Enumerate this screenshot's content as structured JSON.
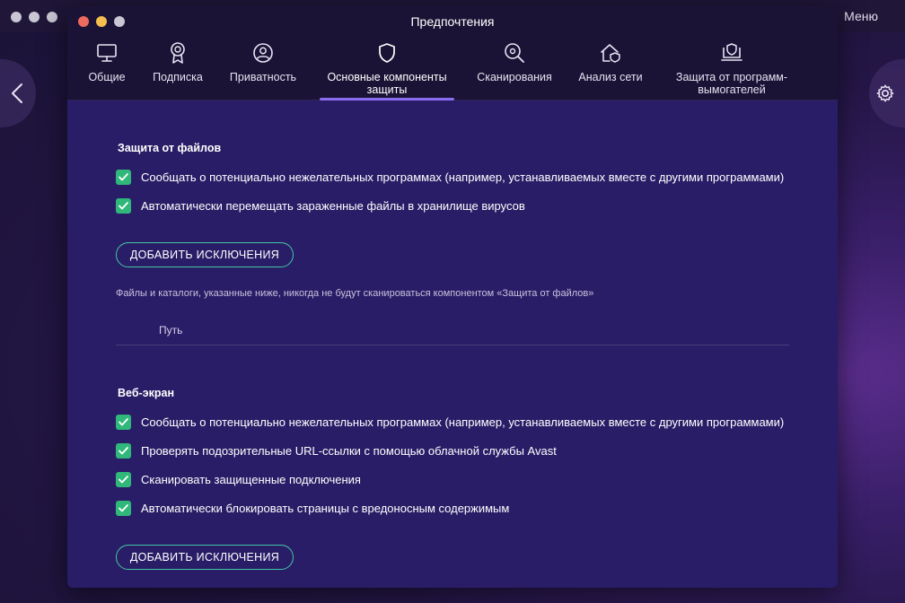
{
  "background": {
    "menu_label": "Меню"
  },
  "window": {
    "title": "Предпочтения"
  },
  "tabs": [
    {
      "label": "Общие",
      "icon": "monitor-icon"
    },
    {
      "label": "Подписка",
      "icon": "badge-icon"
    },
    {
      "label": "Приватность",
      "icon": "fingerprint-icon"
    },
    {
      "label": "Основные компоненты защиты",
      "icon": "shield-icon",
      "active": true
    },
    {
      "label": "Сканирования",
      "icon": "scan-gear-icon"
    },
    {
      "label": "Анализ сети",
      "icon": "home-shield-icon"
    },
    {
      "label": "Защита от программ-вымогателей",
      "icon": "laptop-shield-icon"
    }
  ],
  "file_shield": {
    "title": "Защита от файлов",
    "options": [
      "Сообщать о потенциально нежелательных программах (например, устанавливаемых вместе с другими программами)",
      "Автоматически перемещать зараженные файлы в хранилище вирусов"
    ],
    "add_exceptions_label": "ДОБАВИТЬ ИСКЛЮЧЕНИЯ",
    "note": "Файлы и каталоги, указанные ниже, никогда не будут сканироваться компонентом «Защита от файлов»",
    "column_path": "Путь"
  },
  "web_shield": {
    "title": "Веб-экран",
    "options": [
      "Сообщать о потенциально нежелательных программах (например, устанавливаемых вместе с другими программами)",
      "Проверять подозрительные URL-ссылки с помощью облачной службы Avast",
      "Сканировать защищенные подключения",
      "Автоматически блокировать страницы с вредоносным содержимым"
    ],
    "add_exceptions_label": "ДОБАВИТЬ ИСКЛЮЧЕНИЯ"
  },
  "colors": {
    "accent": "#8a6cf0",
    "checkbox": "#2fb87a",
    "button_border": "#44c7a3",
    "panel": "#2a1d67"
  }
}
